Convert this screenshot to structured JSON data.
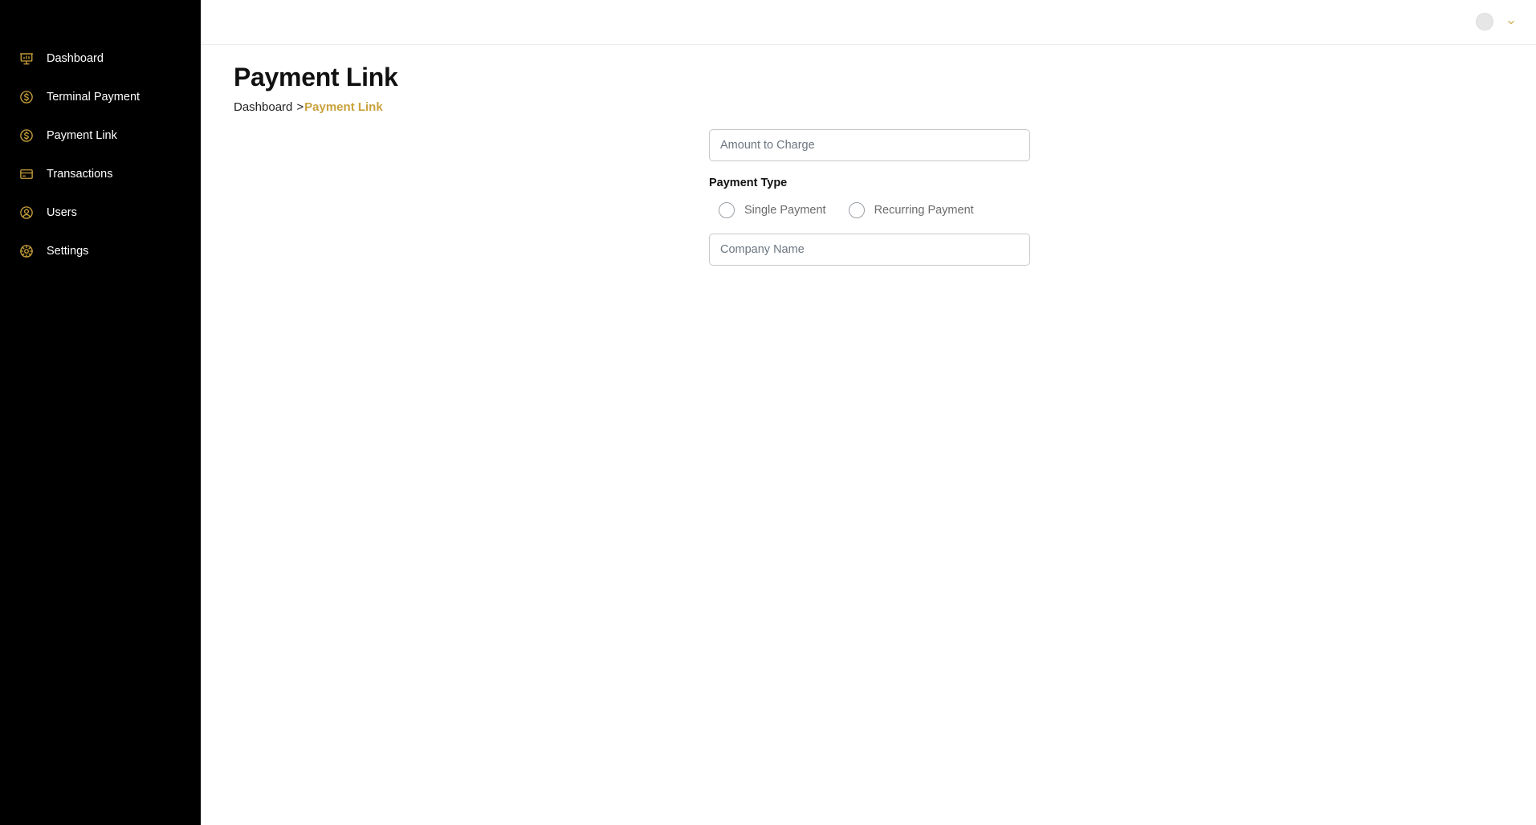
{
  "colors": {
    "accent": "#c9a13b",
    "sidebar_bg": "#000000",
    "sidebar_text": "#ffffff"
  },
  "sidebar": {
    "items": [
      {
        "label": "Dashboard",
        "icon": "presentation-chart-icon"
      },
      {
        "label": "Terminal Payment",
        "icon": "dollar-circle-icon"
      },
      {
        "label": "Payment Link",
        "icon": "dollar-circle-icon"
      },
      {
        "label": "Transactions",
        "icon": "credit-card-icon"
      },
      {
        "label": "Users",
        "icon": "user-circle-icon"
      },
      {
        "label": "Settings",
        "icon": "gear-icon"
      }
    ]
  },
  "header": {
    "avatar": "avatar",
    "menu_icon": "chevron-down-icon"
  },
  "page": {
    "title": "Payment Link",
    "breadcrumb": {
      "home": "Dashboard",
      "separator": ">",
      "current": "Payment Link"
    }
  },
  "form": {
    "amount": {
      "placeholder": "Amount to Charge",
      "value": ""
    },
    "payment_type": {
      "label": "Payment Type",
      "options": [
        "Single Payment",
        "Recurring Payment"
      ],
      "selected": ""
    },
    "company": {
      "placeholder": "Company Name",
      "value": ""
    }
  }
}
